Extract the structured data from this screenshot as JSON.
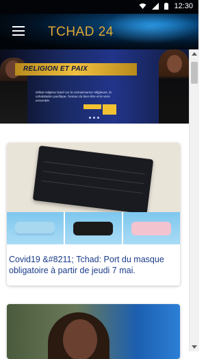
{
  "status_bar": {
    "time": "12:30"
  },
  "app_bar": {
    "title": "TCHAD 24"
  },
  "banner": {
    "heading": "RELIGION ET PAIX",
    "text": "Débat religieux basé sur la connaissance réligieuse, la cohabitation pacifique, l'amour du bien-être et le vivre ensemble.",
    "tag_1": "",
    "tag_2": ""
  },
  "articles": [
    {
      "caption": "Covid19 &#8211; Tchad: Port du masque obligatoire à partir de jeudi 7 mai."
    },
    {
      "caption": ""
    }
  ],
  "colors": {
    "title": "#e0a934",
    "link": "#1a3b8a",
    "app_bar": "#021325"
  }
}
